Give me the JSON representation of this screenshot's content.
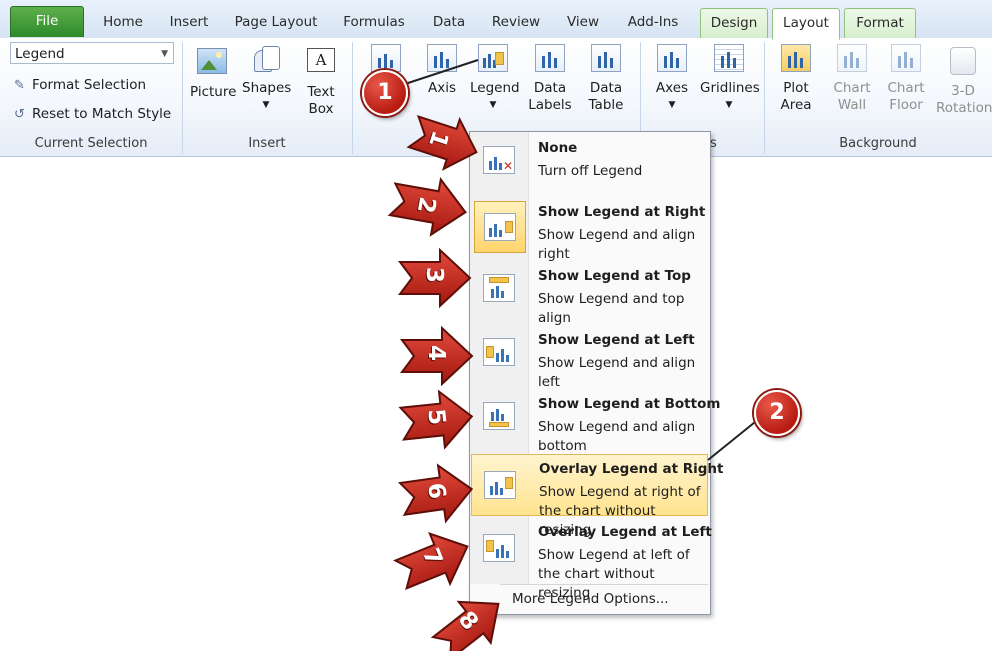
{
  "tabs": [
    {
      "label": "File"
    },
    {
      "label": "Home"
    },
    {
      "label": "Insert"
    },
    {
      "label": "Page Layout"
    },
    {
      "label": "Formulas"
    },
    {
      "label": "Data"
    },
    {
      "label": "Review"
    },
    {
      "label": "View"
    },
    {
      "label": "Add-Ins"
    },
    {
      "label": "Design"
    },
    {
      "label": "Layout"
    },
    {
      "label": "Format"
    }
  ],
  "current_selection": {
    "combo_value": "Legend",
    "format_selection": "Format Selection",
    "reset_style": "Reset to Match Style",
    "group_label": "Current Selection"
  },
  "insert": {
    "picture": "Picture",
    "shapes": "Shapes",
    "text_box": "Text\nBox",
    "group_label": "Insert"
  },
  "labels_group": {
    "chart_title": "Title",
    "axis_titles": "Axis",
    "legend": "Legend",
    "data_labels_1": "Data",
    "data_labels_2": "Labels",
    "data_table_1": "Data",
    "data_table_2": "Table"
  },
  "axes_group": {
    "axes": "Axes",
    "gridlines": "Gridlines",
    "group_label_tail": "s"
  },
  "background": {
    "plot_area_1": "Plot",
    "plot_area_2": "Area",
    "chart_wall_1": "Chart",
    "chart_wall_2": "Wall",
    "chart_floor_1": "Chart",
    "chart_floor_2": "Floor",
    "rotation_1": "3-D",
    "rotation_2": "Rotation",
    "group_label": "Background"
  },
  "menu": {
    "items": [
      {
        "title": "None",
        "desc": "Turn off Legend"
      },
      {
        "title": "Show Legend at Right",
        "desc": "Show Legend and align right"
      },
      {
        "title": "Show Legend at Top",
        "desc": "Show Legend and top align"
      },
      {
        "title": "Show Legend at Left",
        "desc": "Show Legend and align left"
      },
      {
        "title": "Show Legend at Bottom",
        "desc": "Show Legend and align bottom"
      },
      {
        "title": "Overlay Legend at Right",
        "desc": "Show Legend at right of the chart without resizing"
      },
      {
        "title": "Overlay Legend at Left",
        "desc": "Show Legend at left of the chart without resizing"
      }
    ],
    "more_options": "More Legend Options..."
  },
  "annotations": {
    "callouts": [
      "1",
      "2"
    ],
    "arrows": [
      "1",
      "2",
      "3",
      "4",
      "5",
      "6",
      "7",
      "8"
    ]
  },
  "colors": {
    "accent": "#2d8a2a",
    "callout": "#c0261a",
    "hover": "#ffe38e"
  }
}
